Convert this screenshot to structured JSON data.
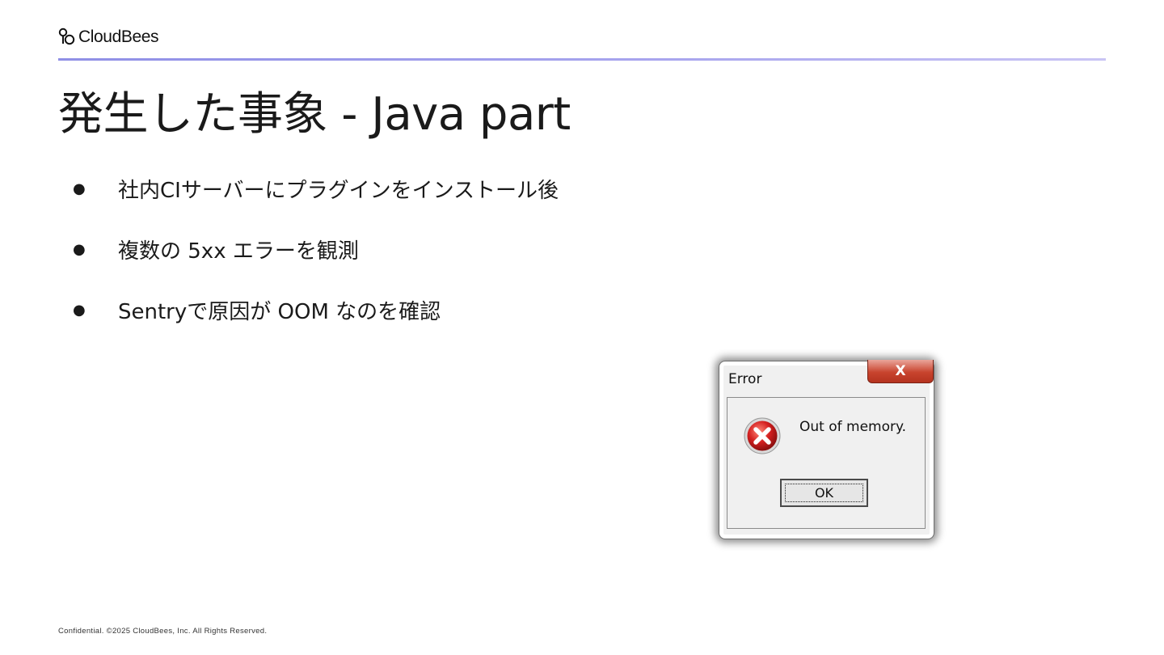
{
  "brand": {
    "name": "CloudBees",
    "icon": "cloudbees-logo-icon"
  },
  "slide": {
    "title": "発生した事象 - Java part",
    "bullets": [
      "社内CIサーバーにプラグインをインストール後",
      "複数の 5xx エラーを観測",
      "Sentryで原因が OOM なのを確認"
    ],
    "bullet_glyph": "●"
  },
  "dialog": {
    "title": "Error",
    "close_glyph": "X",
    "message": "Out of memory.",
    "ok_label": "OK",
    "icon": "error-x-icon"
  },
  "footer": {
    "text": "Confidential. ©2025 CloudBees, Inc. All Rights Reserved."
  },
  "colors": {
    "accent_rule": "#8f8fe6",
    "close_button": "#c8442e",
    "error_icon": "#c81e1e"
  }
}
